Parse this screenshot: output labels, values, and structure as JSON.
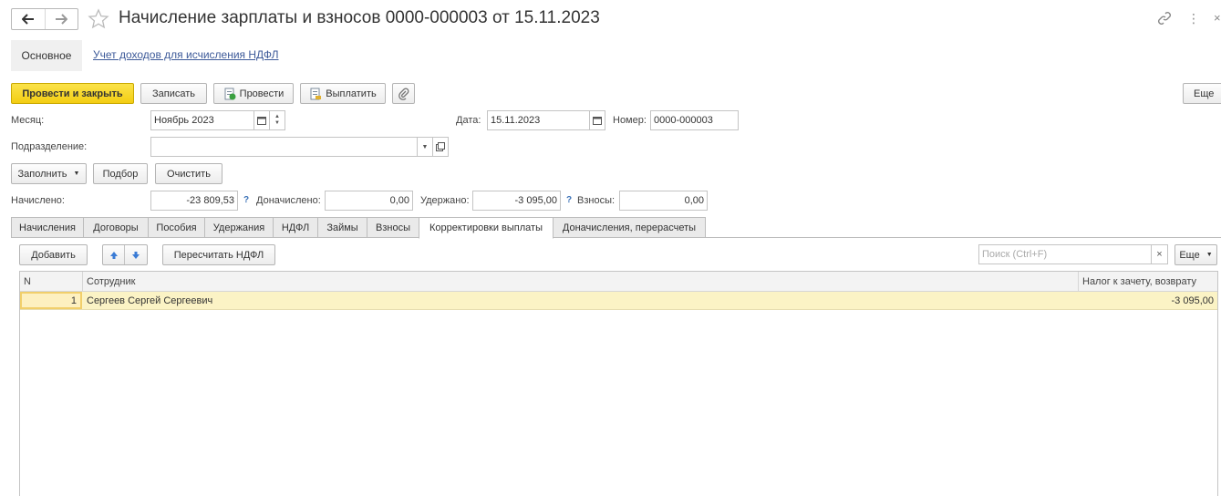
{
  "window": {
    "title": "Начисление зарплаты и взносов 0000-000003 от 15.11.2023",
    "back_icon": "arrow-left-icon",
    "forward_icon": "arrow-right-icon",
    "favorite_icon": "star-icon",
    "link_icon": "link-icon",
    "more_icon": "vertical-dots-icon",
    "close_icon": "close-icon",
    "close_glyph": "×",
    "more_glyph": "⋮"
  },
  "sections": {
    "main": "Основное",
    "ndfl_income": "Учет доходов для исчисления НДФЛ"
  },
  "toolbar": {
    "post_and_close": "Провести и закрыть",
    "save": "Записать",
    "post": "Провести",
    "pay": "Выплатить",
    "more": "Еще"
  },
  "form": {
    "month_label": "Месяц:",
    "month_value": "Ноябрь 2023",
    "date_label": "Дата:",
    "date_value": "15.11.2023",
    "number_label": "Номер:",
    "number_value": "0000-000003",
    "department_label": "Подразделение:",
    "department_value": "",
    "fill_button": "Заполнить",
    "select_button": "Подбор",
    "clear_button": "Очистить",
    "accrued_label": "Начислено:",
    "accrued_value": "-23 809,53",
    "additional_label": "Доначислено:",
    "additional_value": "0,00",
    "withheld_label": "Удержано:",
    "withheld_value": "-3 095,00",
    "contributions_label": "Взносы:",
    "contributions_value": "0,00",
    "help_glyph": "?"
  },
  "tabs": [
    {
      "label": "Начисления",
      "active": false
    },
    {
      "label": "Договоры",
      "active": false
    },
    {
      "label": "Пособия",
      "active": false
    },
    {
      "label": "Удержания",
      "active": false
    },
    {
      "label": "НДФЛ",
      "active": false
    },
    {
      "label": "Займы",
      "active": false
    },
    {
      "label": "Взносы",
      "active": false
    },
    {
      "label": "Корректировки выплаты",
      "active": true
    },
    {
      "label": "Доначисления, перерасчеты",
      "active": false
    }
  ],
  "table_toolbar": {
    "add": "Добавить",
    "move_up_icon": "arrow-up-icon",
    "move_down_icon": "arrow-down-icon",
    "recalc": "Пересчитать НДФЛ",
    "search_placeholder": "Поиск (Ctrl+F)",
    "search_value": "",
    "clear_glyph": "×",
    "more": "Еще"
  },
  "table": {
    "columns": [
      "N",
      "Сотрудник",
      "Налог к зачету, возврату"
    ],
    "rows": [
      {
        "n": "1",
        "employee": "Сергеев Сергей Сергеевич",
        "tax": "-3 095,00"
      }
    ]
  },
  "colors": {
    "primary_button": "#f3cd12",
    "selected_row": "#fbf3c5",
    "link": "#3d5a99"
  }
}
